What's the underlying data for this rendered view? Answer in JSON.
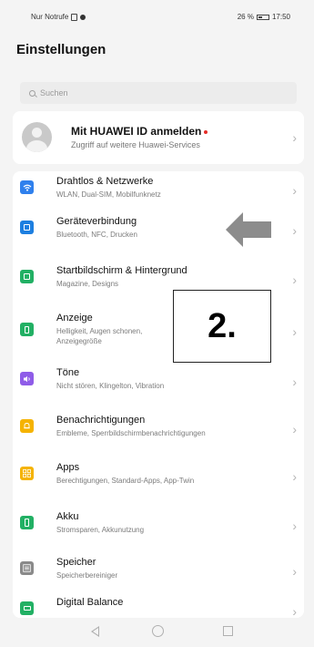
{
  "status_bar": {
    "carrier": "Nur Notrufe",
    "battery_percent": "26 %",
    "time": "17:50"
  },
  "header": {
    "title": "Einstellungen"
  },
  "search": {
    "placeholder": "Suchen"
  },
  "account": {
    "title": "Mit HUAWEI ID anmelden",
    "subtitle": "Zugriff auf weitere Huawei-Services"
  },
  "settings": [
    {
      "label": "Drahtlos & Netzwerke",
      "sub": "WLAN, Dual-SIM, Mobilfunknetz",
      "icon": "wifi-icon",
      "color": "#2f80ed"
    },
    {
      "label": "Geräteverbindung",
      "sub": "Bluetooth, NFC, Drucken",
      "icon": "device-connection-icon",
      "color": "#1d7fe0"
    },
    {
      "label": "Startbildschirm & Hintergrund",
      "sub": "Magazine, Designs",
      "icon": "wallpaper-icon",
      "color": "#22b064"
    },
    {
      "label": "Anzeige",
      "sub": "Helligkeit, Augen schonen,",
      "sub2": "Anzeigegröße",
      "icon": "display-icon",
      "color": "#22b064"
    },
    {
      "label": "Töne",
      "sub": "Nicht stören, Klingelton, Vibration",
      "icon": "sound-icon",
      "color": "#8f5ce8"
    },
    {
      "label": "Benachrichtigungen",
      "sub": "Embleme, Sperrbildschirmbenachrichtigungen",
      "icon": "notification-bell-icon",
      "color": "#f5b301"
    },
    {
      "label": "Apps",
      "sub": "Berechtigungen, Standard-Apps, App-Twin",
      "icon": "apps-icon",
      "color": "#f5b301"
    },
    {
      "label": "Akku",
      "sub": "Stromsparen, Akkunutzung",
      "icon": "battery-icon",
      "color": "#22b064"
    },
    {
      "label": "Speicher",
      "sub": "Speicherbereiniger",
      "icon": "storage-icon",
      "color": "#8a8a8a"
    },
    {
      "label": "Digital Balance",
      "sub": "",
      "icon": "digital-balance-icon",
      "color": "#22b064"
    }
  ],
  "annotation": {
    "text": "2."
  },
  "colors": {
    "accent_arrow": "#8c8c8c"
  }
}
